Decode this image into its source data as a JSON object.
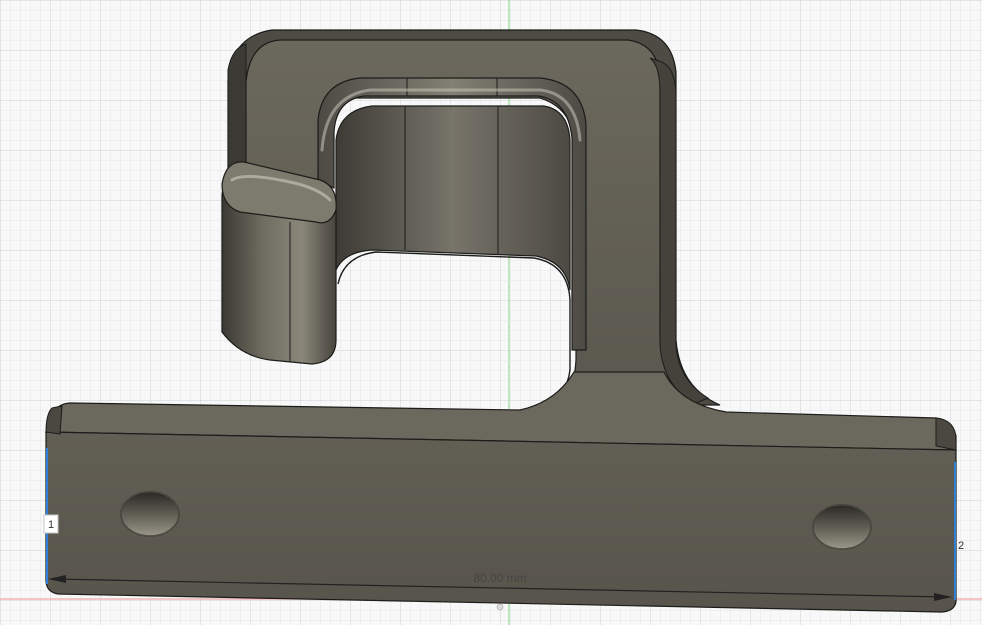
{
  "viewport": {
    "background": "#f7f7f7",
    "grid_minor_color": "#e1e4e6",
    "grid_major_color": "#cfd3d6",
    "axis_green": "#8fd88f",
    "axis_red": "#f1a7a7"
  },
  "model": {
    "face_color": "#5d5a50",
    "face_dark": "#4a4740",
    "edge_color": "#1c1c1a",
    "highlight": "#bab7ab"
  },
  "dimension": {
    "label": "80.00 mm",
    "selection_color": "#2f7fd6"
  },
  "markers": [
    {
      "label": "1"
    },
    {
      "label": "2"
    }
  ]
}
